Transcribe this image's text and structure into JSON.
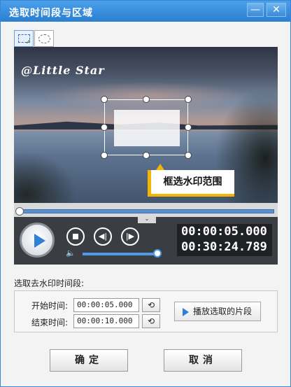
{
  "window": {
    "title": "选取时间段与区域",
    "minimize_glyph": "—",
    "close_glyph": "✕"
  },
  "tools": {
    "rect_icon": "rect-select-icon",
    "ellipse_icon": "ellipse-select-icon"
  },
  "video": {
    "watermark_text": "@Little Star",
    "callout_text": "框选水印范围",
    "seek_fold_glyph": "⌄"
  },
  "player": {
    "current_time": "00:00:05.000",
    "total_time": "00:30:24.789",
    "volume_level": 1.0,
    "seek_position": 0.0
  },
  "range": {
    "section_label": "选取去水印时间段:",
    "start_label": "开始时间:",
    "start_value": "00:00:05.000",
    "end_label": "结束时间:",
    "end_value": "00:00:10.000",
    "set_glyph": "⟲",
    "play_segment_label": "播放选取的片段"
  },
  "buttons": {
    "ok": "确定",
    "cancel": "取消"
  },
  "colors": {
    "accent": "#2f7fd6",
    "callout": "#f5b400",
    "titlebar": "#3a8cdc"
  }
}
